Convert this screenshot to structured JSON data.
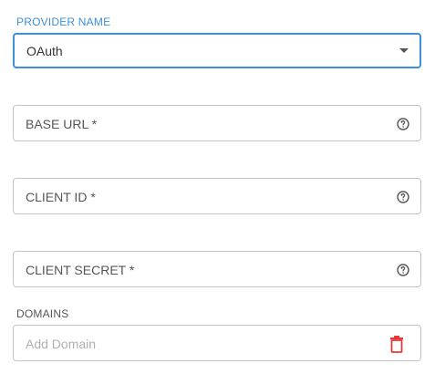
{
  "provider": {
    "label": "PROVIDER NAME",
    "value": "OAuth"
  },
  "fields": {
    "base_url": {
      "label": "BASE URL *"
    },
    "client_id": {
      "label": "CLIENT ID *"
    },
    "client_secret": {
      "label": "CLIENT SECRET *"
    }
  },
  "domains": {
    "label": "DOMAINS",
    "placeholder": "Add Domain"
  },
  "colors": {
    "accent": "#3d8fd6",
    "danger": "#e53935",
    "border": "#c4c4c4"
  },
  "icons": {
    "dropdown": "chevron-down-icon",
    "help": "help-icon",
    "delete": "trash-icon"
  }
}
